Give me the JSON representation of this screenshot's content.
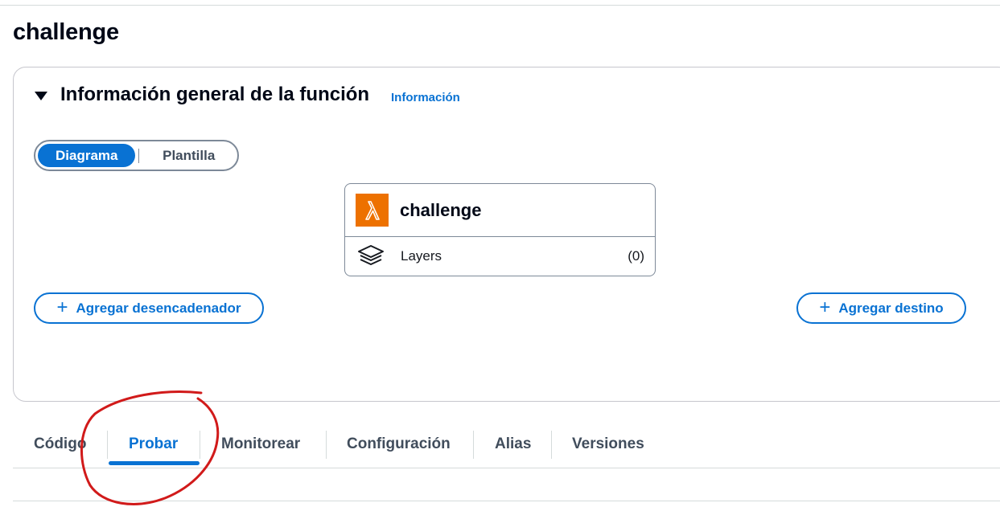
{
  "page": {
    "title": "challenge"
  },
  "overview": {
    "title": "Información general de la función",
    "info_link": "Información",
    "view_toggle": {
      "options": [
        "Diagrama",
        "Plantilla"
      ],
      "selected": "Diagrama"
    },
    "function_card": {
      "name": "challenge",
      "layers_label": "Layers",
      "layers_count": "(0)"
    },
    "add_trigger_label": "Agregar desencadenador",
    "add_destination_label": "Agregar destino"
  },
  "tabs": [
    {
      "label": "Código"
    },
    {
      "label": "Probar",
      "active": true
    },
    {
      "label": "Monitorear"
    },
    {
      "label": "Configuración"
    },
    {
      "label": "Alias"
    },
    {
      "label": "Versiones"
    }
  ],
  "colors": {
    "accent": "#0972d3",
    "lambda_orange": "#ed7100",
    "annotation_red": "#d11a1a"
  },
  "icons": {
    "lambda": "lambda-icon",
    "layers": "layers-icon",
    "caret": "caret-down-icon",
    "plus": "plus-icon"
  }
}
